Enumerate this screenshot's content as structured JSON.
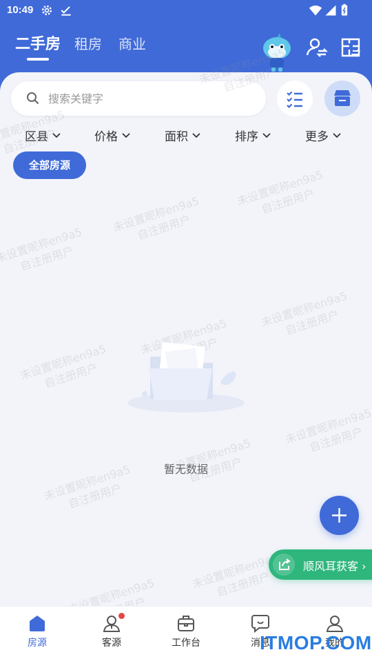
{
  "status_bar": {
    "time": "10:49"
  },
  "top_tabs": [
    {
      "label": "二手房",
      "active": true
    },
    {
      "label": "租房",
      "active": false
    },
    {
      "label": "商业",
      "active": false
    }
  ],
  "search": {
    "placeholder": "搜索关键字",
    "value": ""
  },
  "filters": [
    {
      "label": "区县"
    },
    {
      "label": "价格"
    },
    {
      "label": "面积"
    },
    {
      "label": "排序"
    },
    {
      "label": "更多"
    }
  ],
  "all_listings_button": "全部房源",
  "empty_state": {
    "text": "暂无数据"
  },
  "watermark": {
    "line1": "未设置昵称en9a5",
    "line2": "自注册用户"
  },
  "fab_icon": "plus-icon",
  "promo_pill": {
    "label": "顺风耳获客",
    "chevron": "›"
  },
  "bottom_nav": [
    {
      "label": "房源",
      "icon": "house-icon",
      "active": true
    },
    {
      "label": "客源",
      "icon": "customer-icon",
      "active": false,
      "badge": true
    },
    {
      "label": "工作台",
      "icon": "briefcase-icon",
      "active": false
    },
    {
      "label": "消息",
      "icon": "message-icon",
      "active": false
    },
    {
      "label": "我的",
      "icon": "profile-icon",
      "active": false
    }
  ],
  "site_watermark": "ITMOP.COM",
  "colors": {
    "primary": "#3f6ad8",
    "promo": "#2eb67d",
    "badge": "#e54545"
  }
}
